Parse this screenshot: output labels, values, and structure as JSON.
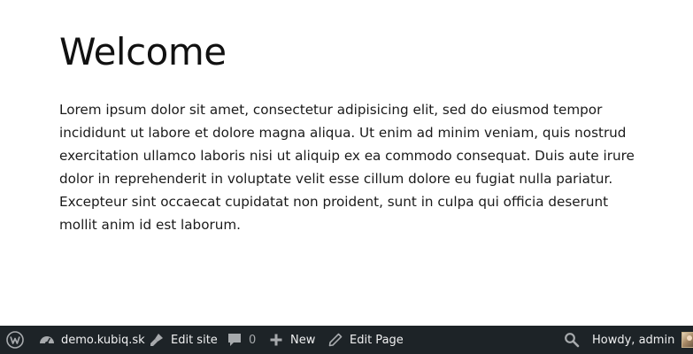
{
  "page": {
    "title": "Welcome",
    "body": "Lorem ipsum dolor sit amet, consectetur adipisicing elit, sed do eiusmod tempor incididunt ut labore et dolore magna aliqua. Ut enim ad minim veniam, quis nostrud exercitation ullamco laboris nisi ut aliquip ex ea commodo consequat. Duis aute irure dolor in reprehenderit in voluptate velit esse cillum dolore eu fugiat nulla pariatur. Excepteur sint occaecat cupidatat non proident, sunt in culpa qui officia deserunt mollit anim id est laborum."
  },
  "adminbar": {
    "background": "#1d2327",
    "text_color": "#f0f0f1",
    "items": {
      "wp_logo": {
        "icon": "wordpress-logo-icon"
      },
      "site": {
        "icon": "dashboard-icon",
        "label": "demo.kubiq.sk"
      },
      "edit_site": {
        "icon": "brush-icon",
        "label": "Edit site"
      },
      "comments": {
        "icon": "comment-icon",
        "count": "0"
      },
      "new": {
        "icon": "plus-icon",
        "label": "New"
      },
      "edit_page": {
        "icon": "pencil-icon",
        "label": "Edit Page"
      },
      "search": {
        "icon": "search-icon"
      },
      "account": {
        "label": "Howdy, admin",
        "avatar": "avatar-image"
      }
    }
  }
}
